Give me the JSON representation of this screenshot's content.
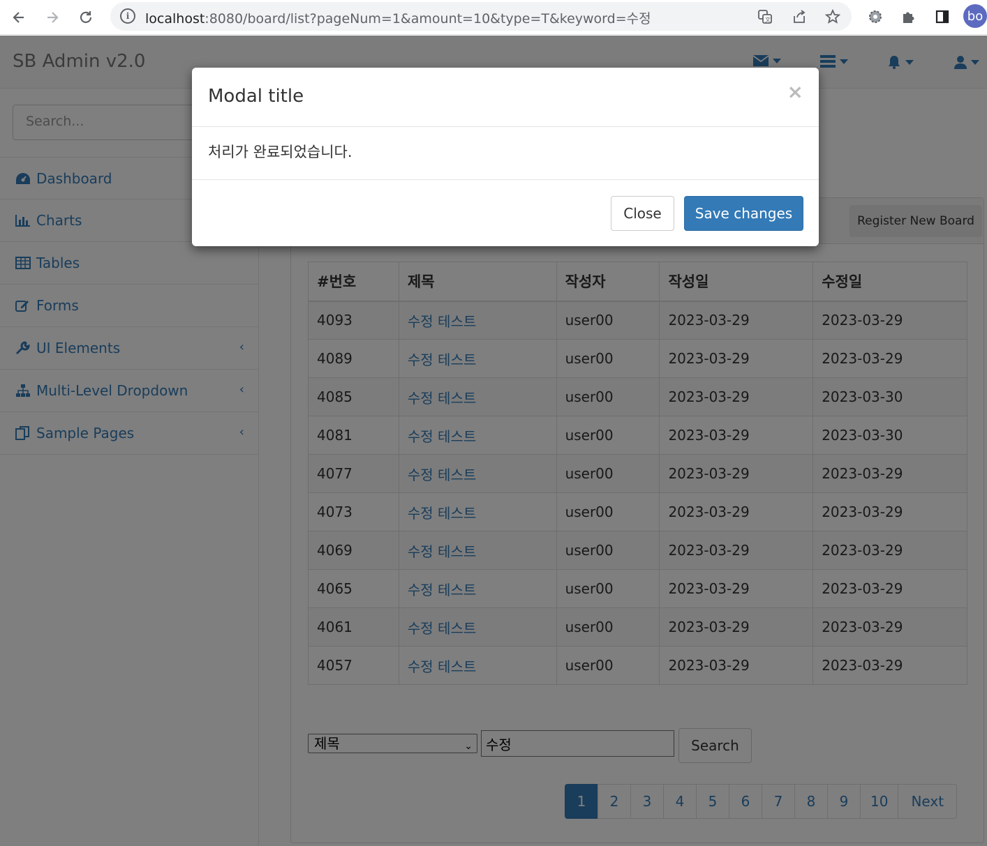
{
  "browser": {
    "url_host": "localhost",
    "url_rest": ":8080/board/list?pageNum=1&amount=10&type=T&keyword=수정",
    "profile_initials": "bo"
  },
  "app": {
    "brand": "SB Admin v2.0",
    "search_placeholder": "Search..."
  },
  "sidebar": {
    "items": [
      {
        "label": "Dashboard",
        "icon": "dashboard-icon"
      },
      {
        "label": "Charts",
        "icon": "bar-chart-icon"
      },
      {
        "label": "Tables",
        "icon": "table-icon"
      },
      {
        "label": "Forms",
        "icon": "edit-icon"
      },
      {
        "label": "UI Elements",
        "icon": "wrench-icon"
      },
      {
        "label": "Multi-Level Dropdown",
        "icon": "sitemap-icon"
      },
      {
        "label": "Sample Pages",
        "icon": "files-icon"
      }
    ]
  },
  "board": {
    "register_label": "Register New Board",
    "headers": [
      "#번호",
      "제목",
      "작성자",
      "작성일",
      "수정일"
    ],
    "rows": [
      [
        "4093",
        "수정 테스트",
        "user00",
        "2023-03-29",
        "2023-03-29"
      ],
      [
        "4089",
        "수정 테스트",
        "user00",
        "2023-03-29",
        "2023-03-29"
      ],
      [
        "4085",
        "수정 테스트",
        "user00",
        "2023-03-29",
        "2023-03-30"
      ],
      [
        "4081",
        "수정 테스트",
        "user00",
        "2023-03-29",
        "2023-03-30"
      ],
      [
        "4077",
        "수정 테스트",
        "user00",
        "2023-03-29",
        "2023-03-29"
      ],
      [
        "4073",
        "수정 테스트",
        "user00",
        "2023-03-29",
        "2023-03-29"
      ],
      [
        "4069",
        "수정 테스트",
        "user00",
        "2023-03-29",
        "2023-03-29"
      ],
      [
        "4065",
        "수정 테스트",
        "user00",
        "2023-03-29",
        "2023-03-29"
      ],
      [
        "4061",
        "수정 테스트",
        "user00",
        "2023-03-29",
        "2023-03-29"
      ],
      [
        "4057",
        "수정 테스트",
        "user00",
        "2023-03-29",
        "2023-03-29"
      ]
    ],
    "search_type": "제목",
    "search_keyword": "수정",
    "search_label": "Search",
    "pages": [
      "1",
      "2",
      "3",
      "4",
      "5",
      "6",
      "7",
      "8",
      "9",
      "10"
    ],
    "next_label": "Next"
  },
  "modal": {
    "title": "Modal title",
    "close_x": "×",
    "body": "처리가 완료되었습니다.",
    "close_label": "Close",
    "save_label": "Save changes"
  }
}
